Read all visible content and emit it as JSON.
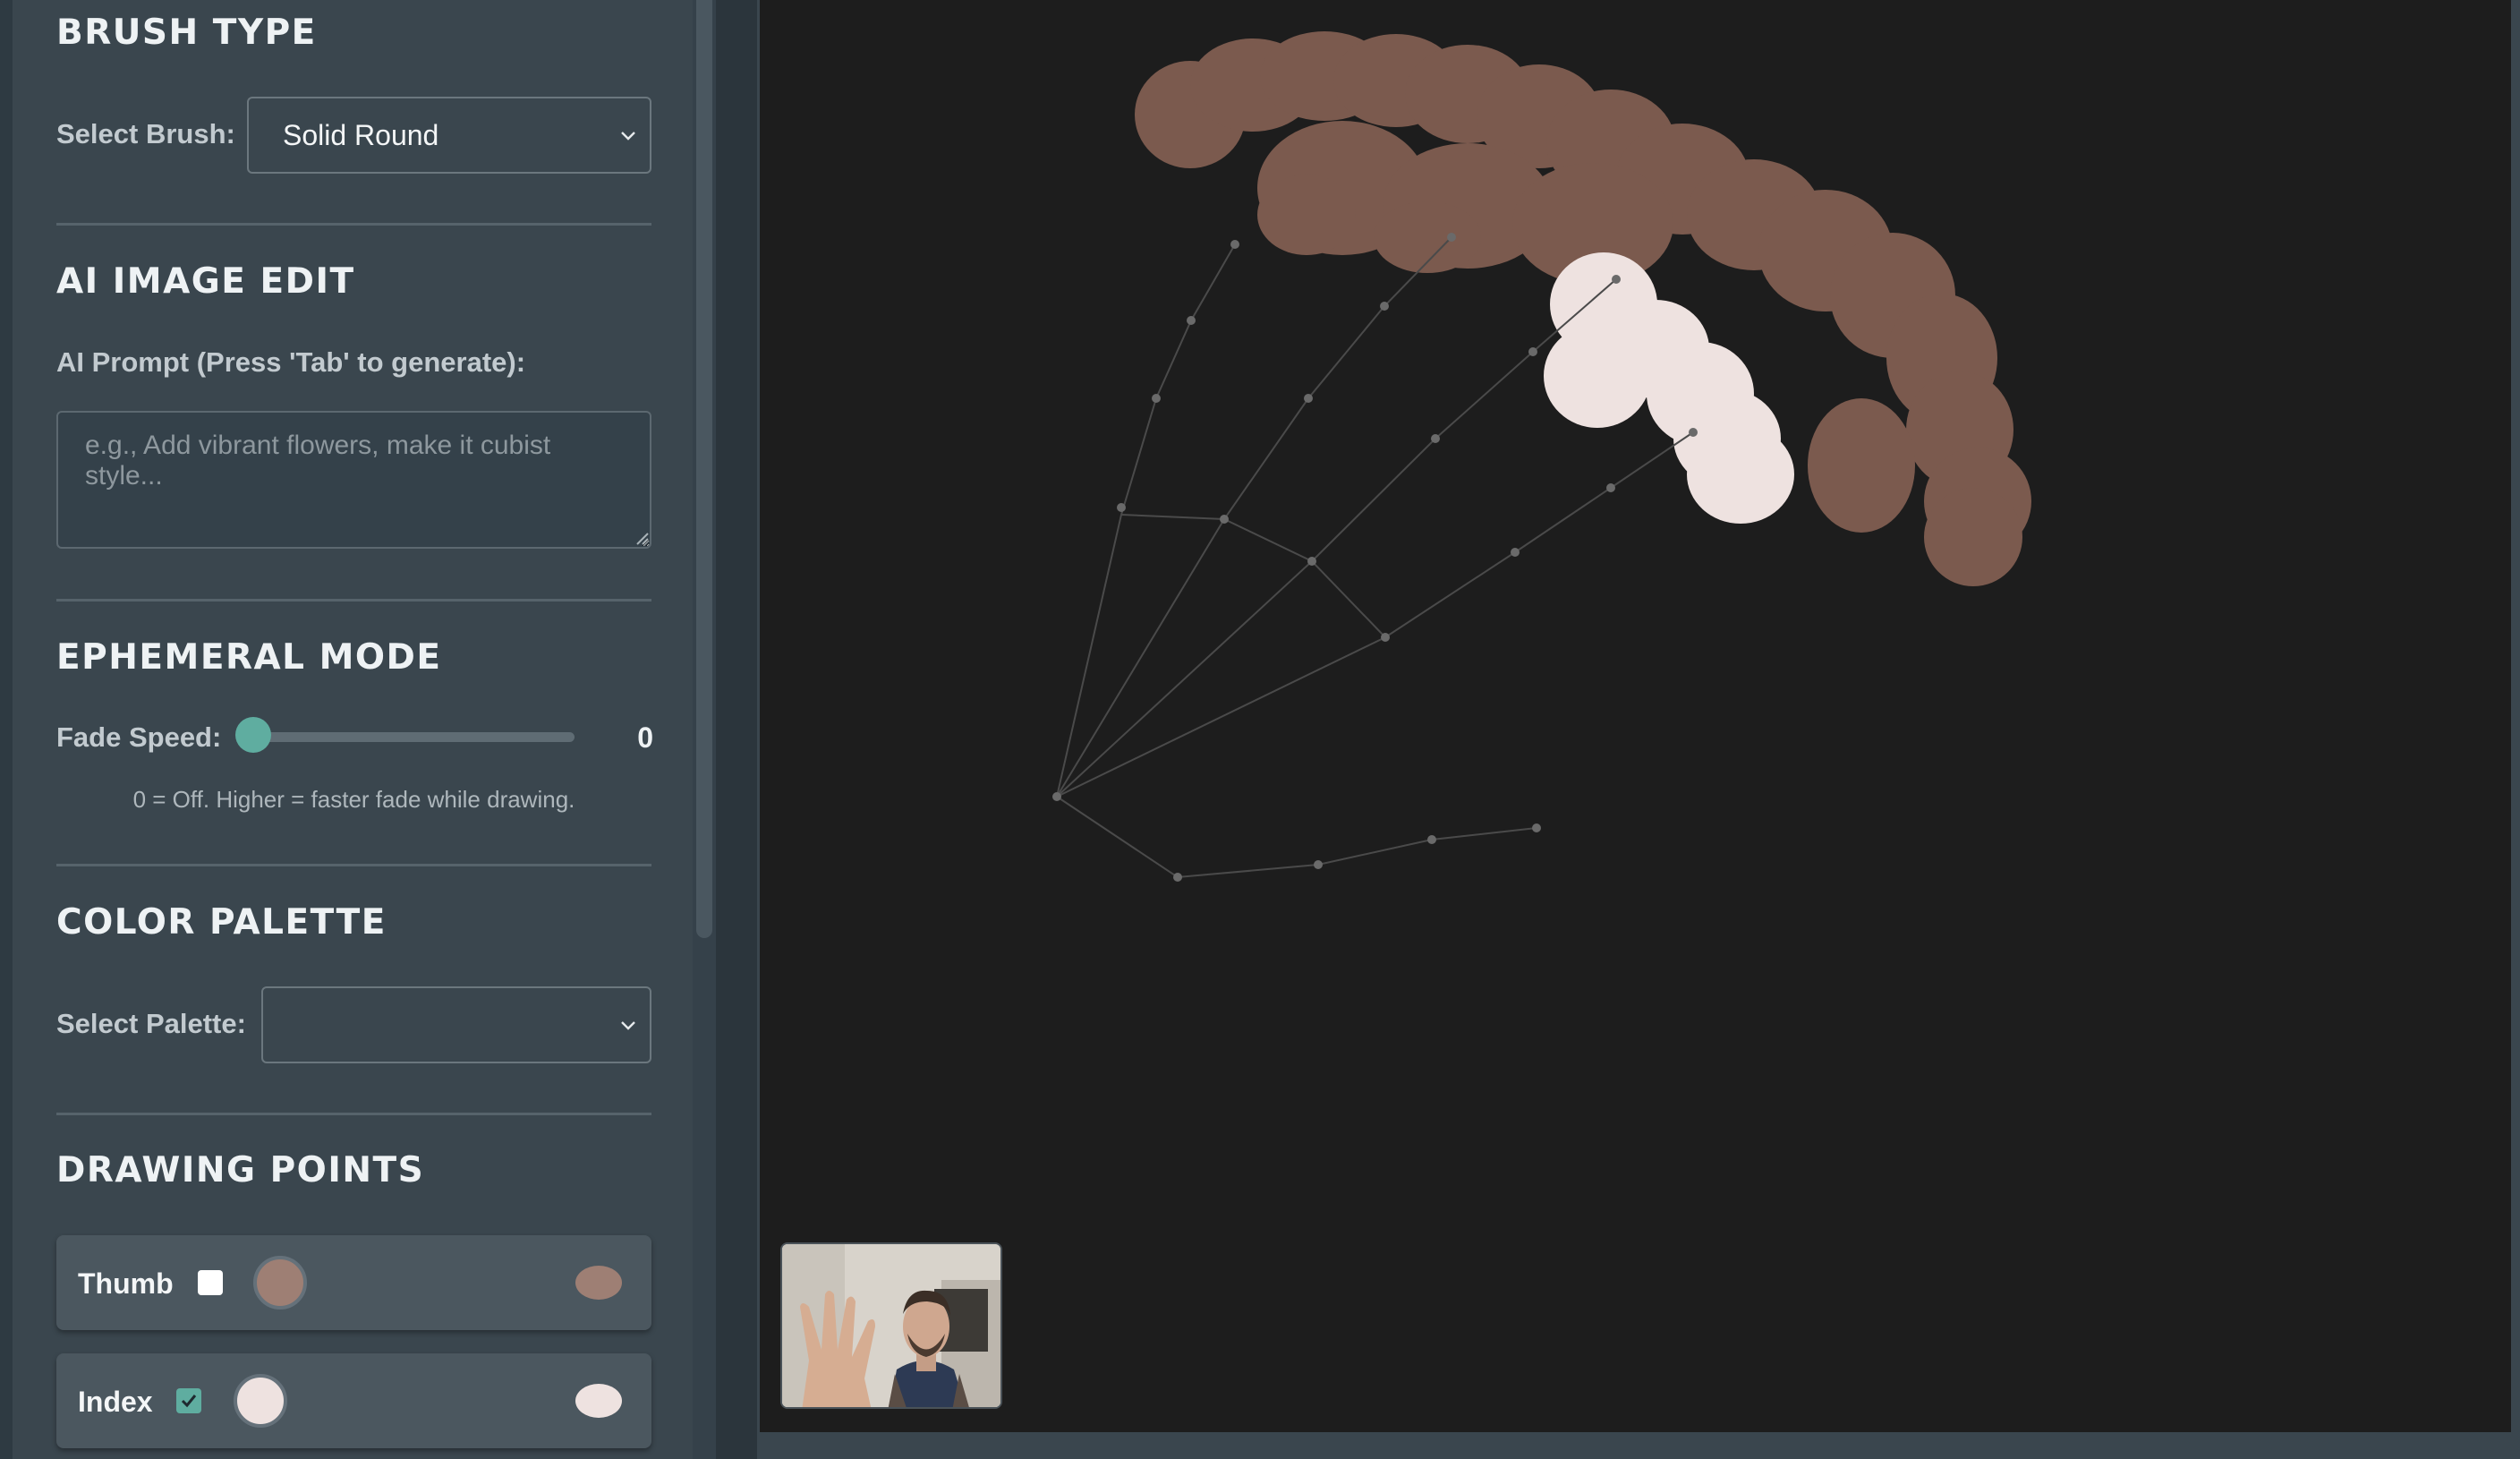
{
  "sidebar": {
    "brush_section": {
      "heading": "BRUSH TYPE",
      "select_label": "Select Brush:",
      "selected_brush": "Solid Round",
      "icon": "chevron-down-icon"
    },
    "ai_section": {
      "heading": "AI IMAGE EDIT",
      "prompt_label": "AI Prompt (Press 'Tab' to generate):",
      "prompt_placeholder": "e.g., Add vibrant flowers, make it cubist style...",
      "prompt_value": ""
    },
    "ephemeral_section": {
      "heading": "EPHEMERAL MODE",
      "slider_label": "Fade Speed:",
      "slider_value": "0",
      "hint": "0 = Off. Higher = faster fade while drawing."
    },
    "palette_section": {
      "heading": "COLOR PALETTE",
      "select_label": "Select Palette:",
      "selected_palette": ""
    },
    "drawing_points": {
      "heading": "DRAWING POINTS",
      "points": [
        {
          "name": "Thumb",
          "checked": false,
          "color": "#9e7f74",
          "preview_color": "#9e7f74"
        },
        {
          "name": "Index",
          "checked": true,
          "color": "#eee2e0",
          "preview_color": "#eee2e0"
        }
      ]
    }
  },
  "colors": {
    "accent": "#5fada0",
    "stroke_brown": "#7b5a4e",
    "stroke_light": "#eee2e0",
    "canvas_bg": "#1d1d1d",
    "sidebar_bg": "#3a464e"
  }
}
